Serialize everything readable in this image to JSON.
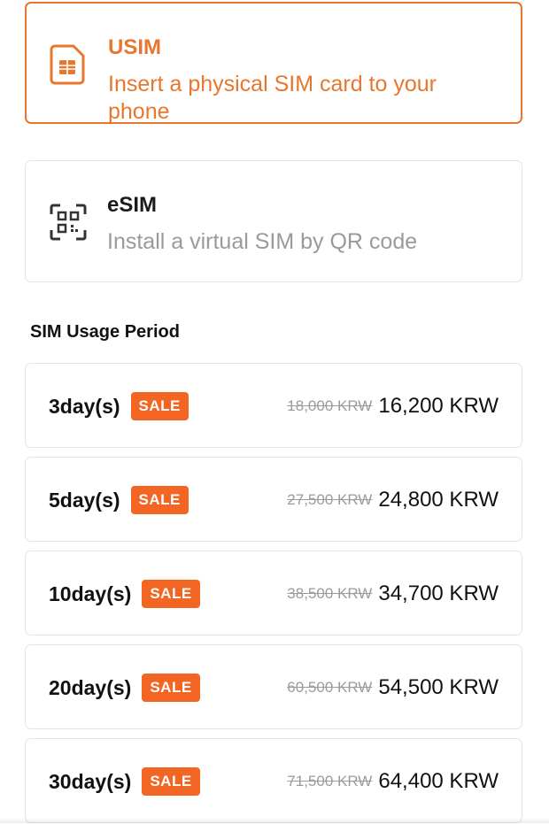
{
  "sim_types": [
    {
      "title": "USIM",
      "description": "Insert a physical SIM card to your phone",
      "selected": true,
      "icon": "sim-card-icon"
    },
    {
      "title": "eSIM",
      "description": "Install a virtual SIM by QR code",
      "selected": false,
      "icon": "qr-code-icon"
    }
  ],
  "section_title": "SIM Usage Period",
  "badge_label": "SALE",
  "periods": [
    {
      "label": "3day(s)",
      "old_price": "18,000 KRW",
      "new_price": "16,200 KRW"
    },
    {
      "label": "5day(s)",
      "old_price": "27,500 KRW",
      "new_price": "24,800 KRW"
    },
    {
      "label": "10day(s)",
      "old_price": "38,500 KRW",
      "new_price": "34,700 KRW"
    },
    {
      "label": "20day(s)",
      "old_price": "60,500 KRW",
      "new_price": "54,500 KRW"
    },
    {
      "label": "30day(s)",
      "old_price": "71,500 KRW",
      "new_price": "64,400 KRW"
    }
  ],
  "colors": {
    "accent": "#e8772e",
    "badge": "#f26522",
    "muted_text": "#9a9a9a",
    "border": "#e4e4e4"
  }
}
